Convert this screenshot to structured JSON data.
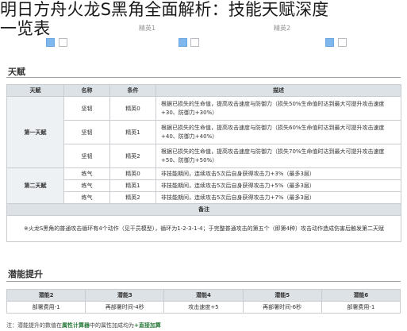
{
  "overlay_title": {
    "line1": "明日方舟火龙S黑角全面解析：技能天赋深度",
    "line2": "一览表"
  },
  "top_strip": {
    "labels": [
      "精英1",
      "精英2"
    ]
  },
  "talent_section": {
    "title": "天赋",
    "headers": [
      "天赋",
      "名称",
      "条件",
      "描述"
    ],
    "groups": [
      {
        "name": "第一天赋",
        "rows": [
          {
            "skill": "坚韧",
            "cond": "精英0",
            "desc": "根据已损失的生命值，提高攻击速度与防御力（损失50%生命值时达到最大可提升攻击速度+30、防御力+30%）"
          },
          {
            "skill": "坚韧",
            "cond": "精英1",
            "desc": "根据已损失的生命值，提高攻击速度与防御力（损失60%生命值时达到最大可提升攻击速度+40、防御力+40%）"
          },
          {
            "skill": "坚韧",
            "cond": "精英2",
            "desc": "根据已损失的生命值，提高攻击速度与防御力（损失70%生命值时达到最大可提升攻击速度+50、防御力+50%）"
          }
        ]
      },
      {
        "name": "第二天赋",
        "rows": [
          {
            "skill": "练气",
            "cond": "精英0",
            "desc": "非技能期间，连续攻击5次后自身获得攻击力+3%（最多3层）"
          },
          {
            "skill": "练气",
            "cond": "精英1",
            "desc": "非技能期间，连续攻击5次后自身获得攻击力+5%（最多3层）"
          },
          {
            "skill": "练气",
            "cond": "精英2",
            "desc": "非技能期间，连续攻击5次后自身获得攻击力+7%（最多3层）"
          }
        ]
      }
    ],
    "note_header": "备注",
    "note_text": "※火龙S黑角的普通攻击循环有4个动作（见干员模型），循环为1-2-3-1-4；于完整普通攻击的第五个（即第4种）攻击动作造成伤害后触发第二天赋"
  },
  "potential_section": {
    "title": "潜能提升",
    "headers": [
      "潜能2",
      "潜能3",
      "潜能4",
      "潜能5",
      "潜能6"
    ],
    "values": [
      "部署费用-1",
      "再部署时间-4秒",
      "攻击速度+5",
      "再部署时间-6秒",
      "部署费用-1"
    ]
  },
  "footnote": {
    "prefix": "注：潜能提升的数值在",
    "bold": "属性计算器",
    "suffix": "中的属性加成均为",
    "plus": "+直接加算"
  }
}
